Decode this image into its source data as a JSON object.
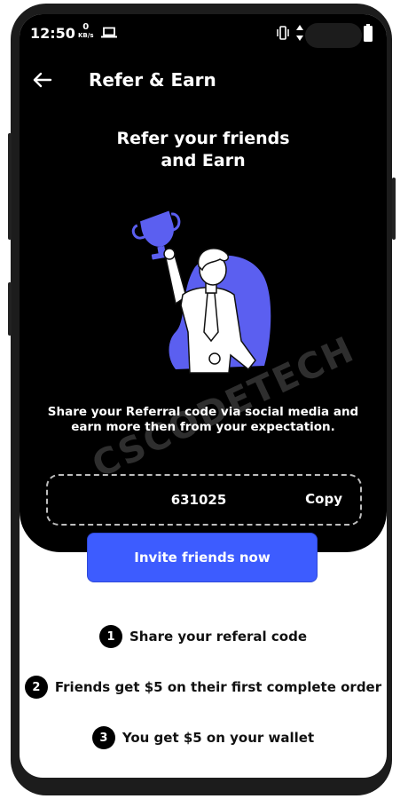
{
  "status_bar": {
    "time": "12:50",
    "net_speed_value": "0",
    "net_speed_unit": "KB/s"
  },
  "app_bar": {
    "title": "Refer & Earn",
    "back_icon": "arrow-left-icon"
  },
  "hero": {
    "headline_line1": "Refer your friends",
    "headline_line2": "and Earn",
    "illustration": "man-holding-trophy-illustration",
    "description_line1": "Share your Referral code via social media and",
    "description_line2": "earn more then from your expectation."
  },
  "referral": {
    "code": "631025",
    "copy_label": "Copy"
  },
  "invite_button_label": "Invite friends now",
  "steps": [
    {
      "number": "1",
      "text": "Share your referal code"
    },
    {
      "number": "2",
      "text": "Friends get $5 on their first complete order"
    },
    {
      "number": "3",
      "text": "You get $5 on your wallet"
    }
  ],
  "watermark": "CSCODETECH",
  "colors": {
    "accent": "#3d5cff",
    "illustration": "#5b5ff0",
    "background_dark": "#000000",
    "background_light": "#ffffff"
  }
}
